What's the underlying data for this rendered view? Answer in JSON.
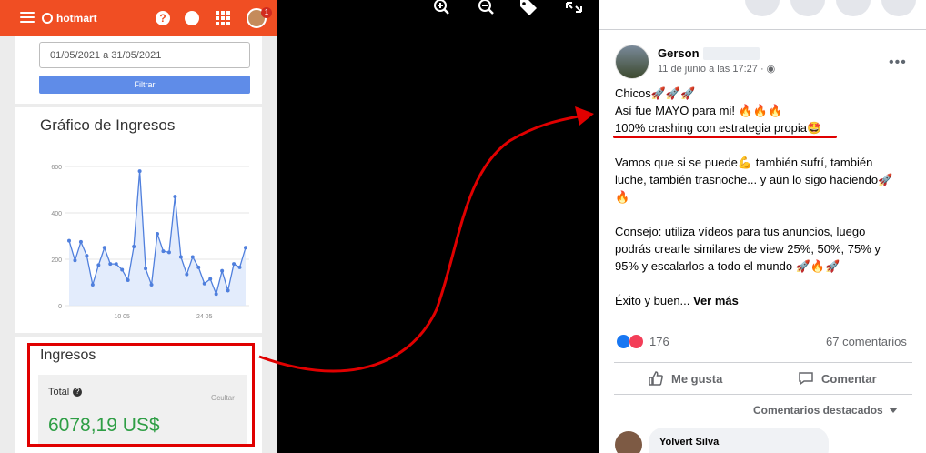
{
  "hotmart": {
    "brand": "hotmart",
    "help_icon_text": "?",
    "notification_count": "1",
    "date_range_value": "01/05/2021 a 31/05/2021",
    "filter_label": "Filtrar",
    "chart_title": "Gráfico de Ingresos",
    "ingresos_title": "Ingresos",
    "total_label": "Total",
    "hide_label": "Ocultar",
    "total_amount": "6078,19 US$",
    "accent_color": "#f04e23",
    "amount_color": "#2e9e45"
  },
  "chart_data": {
    "type": "area",
    "title": "Gráfico de Ingresos",
    "x_tick_labels": [
      "10 05",
      "24 05"
    ],
    "y_tick_labels": [
      "0",
      "200",
      "400",
      "600"
    ],
    "ylim": [
      0,
      600
    ],
    "grid": true,
    "x": [
      1,
      2,
      3,
      4,
      5,
      6,
      7,
      8,
      9,
      10,
      11,
      12,
      13,
      14,
      15,
      16,
      17,
      18,
      19,
      20,
      21,
      22,
      23,
      24,
      25,
      26,
      27,
      28,
      29,
      30,
      31
    ],
    "values": [
      280,
      195,
      275,
      215,
      90,
      175,
      250,
      180,
      180,
      155,
      110,
      255,
      580,
      160,
      90,
      310,
      235,
      230,
      470,
      210,
      135,
      210,
      165,
      95,
      115,
      50,
      150,
      65,
      180,
      165,
      250
    ],
    "series_color": "#4f7fdd"
  },
  "viewer": {
    "icons": [
      "zoom-in-icon",
      "zoom-out-icon",
      "tag-icon",
      "fullscreen-icon"
    ]
  },
  "post": {
    "author": "Gerson",
    "date": "11 de junio a las 17:27 · ",
    "lines": [
      "Chicos🚀🚀🚀",
      "Así fue MAYO para mi! 🔥🔥🔥",
      "100% crashing con estrategia propia🤩",
      "",
      "Vamos que si se puede💪 también sufrí, también",
      "luche, también trasnoche... y aún lo sigo haciendo🚀",
      "🔥",
      "",
      "Consejo: utiliza vídeos para tus anuncios, luego",
      "podrás crearle similares de view 25%, 50%, 75% y",
      "95% y escalarlos a todo el mundo 🚀🔥🚀",
      "",
      "Éxito y buen..."
    ],
    "see_more": "Ver más",
    "reaction_count": "176",
    "comments_count": "67 comentarios",
    "like_label": "Me gusta",
    "comment_label": "Comentar",
    "featured_comments": "Comentarios destacados",
    "commenter": "Yolvert Silva",
    "highlight_color": "#e00000"
  }
}
